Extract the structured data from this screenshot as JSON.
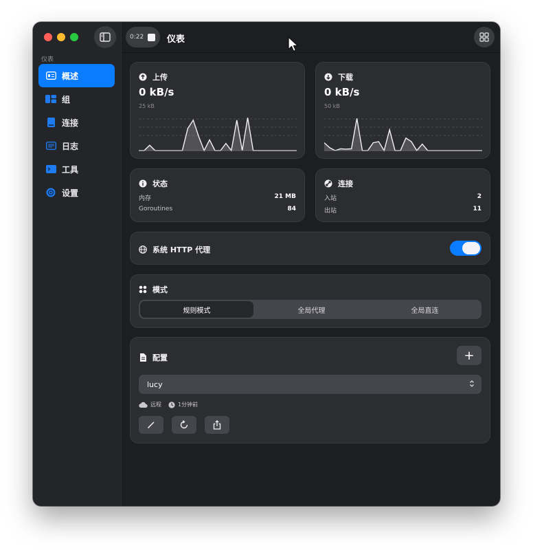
{
  "window": {
    "title": "仪表",
    "recording_time": "0:22"
  },
  "sidebar": {
    "section_label": "仪表",
    "items": [
      {
        "label": "概述",
        "icon": "overview-icon",
        "active": true
      },
      {
        "label": "组",
        "icon": "groups-icon",
        "active": false
      },
      {
        "label": "连接",
        "icon": "connections-icon",
        "active": false
      },
      {
        "label": "日志",
        "icon": "logs-icon",
        "active": false
      },
      {
        "label": "工具",
        "icon": "tools-icon",
        "active": false
      },
      {
        "label": "设置",
        "icon": "settings-icon",
        "active": false
      }
    ]
  },
  "upload": {
    "title": "上传",
    "speed": "0 kB/s",
    "scale": "25 kB",
    "series": [
      0,
      0,
      0.15,
      0,
      0,
      0,
      0,
      0,
      0,
      0.62,
      0.85,
      0.4,
      0,
      0.3,
      0,
      0,
      0.2,
      0,
      0.85,
      0,
      0.92,
      0,
      0,
      0,
      0,
      0,
      0,
      0,
      0,
      0
    ]
  },
  "download": {
    "title": "下载",
    "speed": "0 kB/s",
    "scale": "50 kB",
    "series": [
      0.22,
      0.08,
      0,
      0.05,
      0.04,
      0.05,
      0.9,
      0,
      0,
      0.22,
      0.25,
      0,
      0.58,
      0,
      0,
      0.35,
      0.25,
      0,
      0.18,
      0,
      0,
      0,
      0,
      0,
      0,
      0,
      0,
      0,
      0,
      0
    ]
  },
  "status": {
    "title": "状态",
    "rows": [
      {
        "key": "内存",
        "value": "21 MB"
      },
      {
        "key": "Goroutines",
        "value": "84"
      }
    ]
  },
  "connections": {
    "title": "连接",
    "rows": [
      {
        "key": "入站",
        "value": "2"
      },
      {
        "key": "出站",
        "value": "11"
      }
    ]
  },
  "system_proxy": {
    "label": "系统 HTTP 代理",
    "enabled": true
  },
  "mode": {
    "title": "模式",
    "options": [
      "规则模式",
      "全局代理",
      "全局直连"
    ],
    "selected": "规则模式"
  },
  "profile": {
    "title": "配置",
    "add_label": "+",
    "selected": "lucy",
    "source": "远程",
    "updated": "1分钟前"
  },
  "colors": {
    "accent": "#0a7cff",
    "window_bg": "#1d1e21",
    "card_bg": "#2c2d31"
  }
}
